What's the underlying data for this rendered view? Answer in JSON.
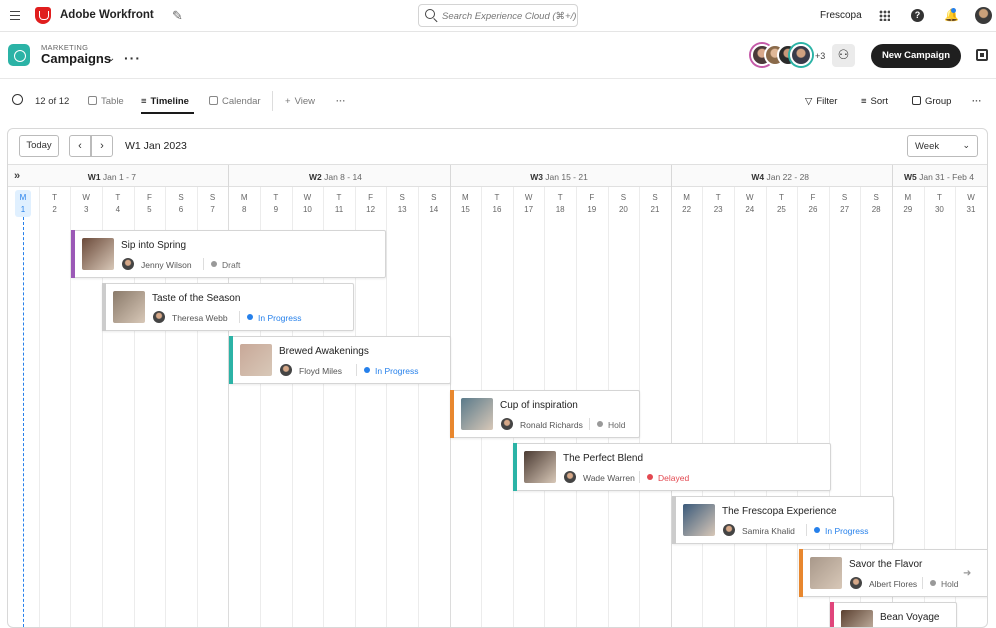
{
  "topbar": {
    "app_title": "Adobe Workfront",
    "search_placeholder": "Search Experience Cloud (⌘+/)",
    "org": "Frescopa",
    "icons": [
      "menu-icon",
      "adobe-logo",
      "pin-icon",
      "search-icon",
      "apps-icon",
      "help-icon",
      "bell-icon",
      "user-avatar"
    ]
  },
  "header": {
    "eyebrow": "MARKETING",
    "title": "Campaigns",
    "more_count": "+3",
    "new_button": "New Campaign"
  },
  "toolbar": {
    "count": "12 of 12",
    "views": [
      "Table",
      "Timeline",
      "Calendar"
    ],
    "add_view": "View",
    "filter": "Filter",
    "sort": "Sort",
    "group": "Group"
  },
  "timeline": {
    "today_button": "Today",
    "range_label": "W1 Jan 2023",
    "scale": "Week",
    "weeks": [
      {
        "code": "W1",
        "range": "Jan 1 - 7"
      },
      {
        "code": "W2",
        "range": "Jan 8 - 14"
      },
      {
        "code": "W3",
        "range": "Jan 15 - 21"
      },
      {
        "code": "W4",
        "range": "Jan 22 - 28"
      },
      {
        "code": "W5",
        "range": "Jan 31 - Feb 4"
      }
    ],
    "days": [
      {
        "d": "M",
        "n": "1"
      },
      {
        "d": "T",
        "n": "2"
      },
      {
        "d": "W",
        "n": "3"
      },
      {
        "d": "T",
        "n": "4"
      },
      {
        "d": "F",
        "n": "5"
      },
      {
        "d": "S",
        "n": "6"
      },
      {
        "d": "S",
        "n": "7"
      },
      {
        "d": "M",
        "n": "8"
      },
      {
        "d": "T",
        "n": "9"
      },
      {
        "d": "W",
        "n": "10"
      },
      {
        "d": "T",
        "n": "11"
      },
      {
        "d": "F",
        "n": "12"
      },
      {
        "d": "S",
        "n": "13"
      },
      {
        "d": "S",
        "n": "14"
      },
      {
        "d": "M",
        "n": "15"
      },
      {
        "d": "T",
        "n": "16"
      },
      {
        "d": "W",
        "n": "17"
      },
      {
        "d": "T",
        "n": "18"
      },
      {
        "d": "F",
        "n": "19"
      },
      {
        "d": "S",
        "n": "20"
      },
      {
        "d": "S",
        "n": "21"
      },
      {
        "d": "M",
        "n": "22"
      },
      {
        "d": "T",
        "n": "23"
      },
      {
        "d": "W",
        "n": "24"
      },
      {
        "d": "T",
        "n": "25"
      },
      {
        "d": "F",
        "n": "26"
      },
      {
        "d": "S",
        "n": "27"
      },
      {
        "d": "S",
        "n": "28"
      },
      {
        "d": "M",
        "n": "29"
      },
      {
        "d": "T",
        "n": "30"
      },
      {
        "d": "W",
        "n": "31"
      }
    ],
    "campaigns": [
      {
        "title": "Sip into Spring",
        "owner": "Jenny Wilson",
        "status": "Draft",
        "accent": "#9b59b6",
        "status_color": "#999999",
        "text_color": "#666666",
        "thumb": "#6b4a3a"
      },
      {
        "title": "Taste of the Season",
        "owner": "Theresa Webb",
        "status": "In Progress",
        "accent": "#cccccc",
        "status_color": "#2680eb",
        "text_color": "#2680eb",
        "thumb": "#8a7a6a"
      },
      {
        "title": "Brewed Awakenings",
        "owner": "Floyd Miles",
        "status": "In Progress",
        "accent": "#2bb3a6",
        "status_color": "#2680eb",
        "text_color": "#2680eb",
        "thumb": "#c8a898"
      },
      {
        "title": "Cup of inspiration",
        "owner": "Ronald Richards",
        "status": "Hold",
        "accent": "#e8872e",
        "status_color": "#999999",
        "text_color": "#666666",
        "thumb": "#5a7a8a"
      },
      {
        "title": "The Perfect Blend",
        "owner": "Wade Warren",
        "status": "Delayed",
        "accent": "#2bb3a6",
        "status_color": "#e34850",
        "text_color": "#e34850",
        "thumb": "#4a3a32"
      },
      {
        "title": "The Frescopa Experience",
        "owner": "Samira Khalid",
        "status": "In Progress",
        "accent": "#cccccc",
        "status_color": "#2680eb",
        "text_color": "#2680eb",
        "thumb": "#3a5a7a"
      },
      {
        "title": "Savor the Flavor",
        "owner": "Albert Flores",
        "status": "Hold",
        "accent": "#e8872e",
        "status_color": "#999999",
        "text_color": "#666666",
        "thumb": "#a8988a"
      },
      {
        "title": "Bean Voyage",
        "owner": "",
        "status": "",
        "accent": "#e0457b",
        "status_color": "#999999",
        "text_color": "#666666",
        "thumb": "#5a4030"
      }
    ]
  }
}
